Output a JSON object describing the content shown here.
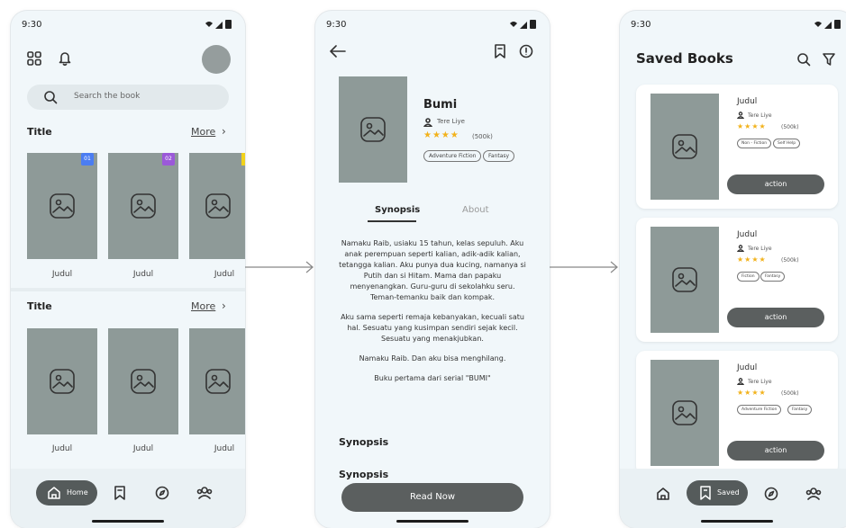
{
  "status_time": "9:30",
  "home": {
    "search_placeholder": "Search the book",
    "sections": [
      {
        "title": "Title",
        "more": "More",
        "books": [
          "Judul",
          "Judul",
          "Judul"
        ],
        "ribbons": [
          "01",
          "02"
        ]
      },
      {
        "title": "Title",
        "more": "More",
        "books": [
          "Judul",
          "Judul",
          "Judul"
        ]
      }
    ],
    "nav": {
      "home_label": "Home"
    }
  },
  "detail": {
    "title": "Bumi",
    "author": "Tere Liye",
    "rating_count": "(500k)",
    "stars": 4,
    "tags": [
      "Adventure Fiction",
      "Fantasy"
    ],
    "tabs": [
      "Synopsis",
      "About"
    ],
    "synopsis_paragraphs": [
      "Namaku Raib, usiaku 15 tahun, kelas sepuluh. Aku anak perempuan seperti kalian, adik-adik kalian, tetangga kalian. Aku punya dua kucing, namanya si Putih dan si Hitam. Mama dan papaku menyenangkan. Guru-guru di sekolahku seru. Teman-temanku baik dan kompak.",
      "Aku sama seperti remaja kebanyakan, kecuali satu hal. Sesuatu yang kusimpan sendiri sejak kecil. Sesuatu yang menakjubkan.",
      "Namaku Raib. Dan aku bisa menghilang.",
      "Buku pertama dari serial \"BUMI\""
    ],
    "section_headings": [
      "Synopsis",
      "Synopsis"
    ],
    "read_button": "Read Now"
  },
  "saved": {
    "title": "Saved Books",
    "cards": [
      {
        "title": "Judul",
        "author": "Tere Liye",
        "count": "(500k)",
        "tags": [
          "Non - Fiction",
          "Self Help"
        ],
        "action": "action"
      },
      {
        "title": "Judul",
        "author": "Tere Liye",
        "count": "(500k)",
        "tags": [
          "Fiction",
          "Fantasy"
        ],
        "action": "action"
      },
      {
        "title": "Judul",
        "author": "Tere Liye",
        "count": "(500k)",
        "tags": [
          "Adventure Fiction",
          "Fantasy"
        ],
        "action": "action"
      }
    ],
    "nav": {
      "saved_label": "Saved"
    }
  },
  "colors": {
    "accent": "#5b5f5f",
    "cover": "#8e9a98",
    "star": "#f2b21b",
    "ribbon_blue": "#4b7df2",
    "ribbon_purple": "#9b59d9",
    "ribbon_yellow": "#f1d21a"
  }
}
